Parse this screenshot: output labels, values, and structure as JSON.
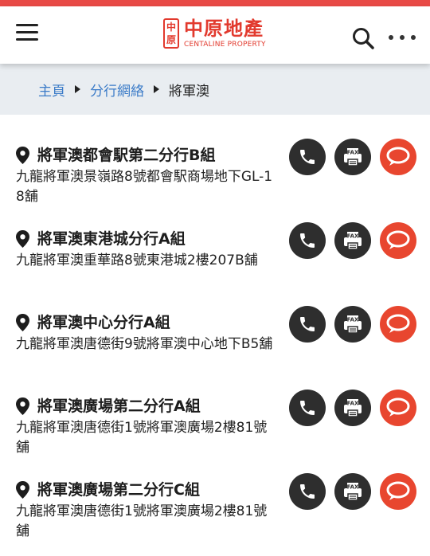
{
  "header": {
    "logo_seal": "中原",
    "logo_zh": "中原地產",
    "logo_en": "CENTALINE PROPERTY",
    "icons": [
      "menu-icon",
      "search-icon",
      "more-icon"
    ]
  },
  "breadcrumb": {
    "items": [
      "主頁",
      "分行網絡"
    ],
    "current": "將軍澳"
  },
  "branches": [
    {
      "name": "將軍澳都會駅第二分行B組",
      "address": "九龍將軍澳景嶺路8號都會駅商場地下GL-18舖"
    },
    {
      "name": "將軍澳東港城分行A組",
      "address": "九龍將軍澳重華路8號東港城2樓207B舖"
    },
    {
      "name": "將軍澳中心分行A組",
      "address": "九龍將軍澳唐德街9號將軍澳中心地下B5舖"
    },
    {
      "name": "將軍澳廣場第二分行A組",
      "address": "九龍將軍澳唐德街1號將軍澳廣場2樓81號舖"
    },
    {
      "name": "將軍澳廣場第二分行C組",
      "address": "九龍將軍澳唐德街1號將軍澳廣場2樓81號舖"
    }
  ],
  "action_icons": {
    "phone": "phone-icon",
    "fax": "fax-icon",
    "chat": "chat-icon",
    "fax_label": "FAX"
  },
  "colors": {
    "brand": "#e23a2e",
    "chat": "#e8462f",
    "link": "#3b7bc8",
    "breadcrumb_bg": "#e9edf1"
  }
}
